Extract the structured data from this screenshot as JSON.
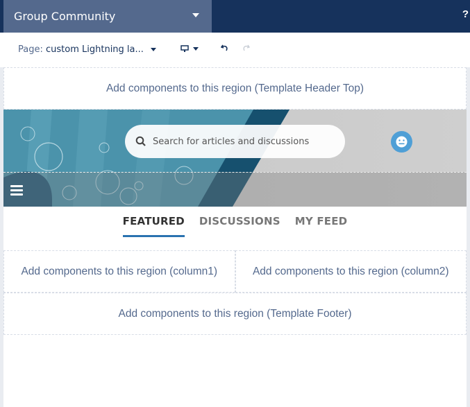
{
  "topbar": {
    "community_name": "Group Community",
    "help_label": "?"
  },
  "toolbar": {
    "page_label": "Page:",
    "page_value": "custom Lightning la...",
    "device_icon": "desktop-icon",
    "undo_icon": "undo-icon",
    "redo_icon": "redo-icon"
  },
  "regions": {
    "header_top": "Add components to this region (Template Header Top)",
    "column1": "Add components to this region (column1)",
    "column2": "Add components to this region (column2)",
    "footer": "Add components to this region (Template Footer)"
  },
  "banner": {
    "search_placeholder": "Search for articles and discussions",
    "avatar_icon": "smiley-icon",
    "menu_icon": "hamburger-icon"
  },
  "tabs": [
    {
      "label": "FEATURED",
      "active": true
    },
    {
      "label": "DISCUSSIONS",
      "active": false
    },
    {
      "label": "MY FEED",
      "active": false
    }
  ],
  "colors": {
    "topbar": "#16325c",
    "community_selector": "#54698d",
    "tab_accent": "#2a73b0",
    "avatar": "#4f9fd6"
  }
}
